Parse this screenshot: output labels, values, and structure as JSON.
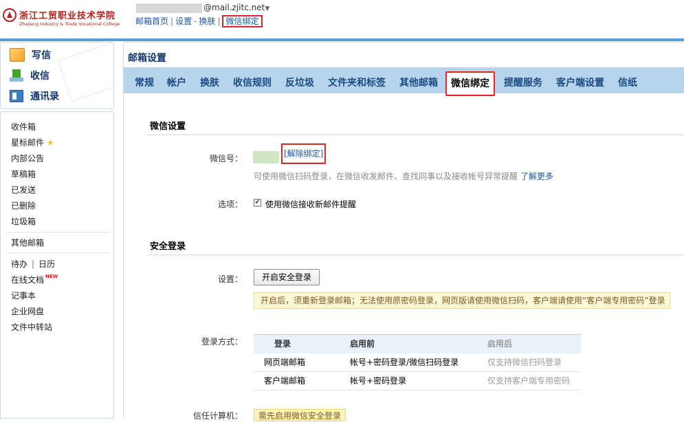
{
  "header": {
    "logo_cn": "浙江工贸职业技术学院",
    "logo_en": "Zhejiang Industry & Trade Vocational College",
    "account_suffix": "@mail.zjitc.net",
    "account_caret": "▼",
    "nav": {
      "home": "邮箱首页",
      "settings": "设置",
      "skin": "换肤",
      "wechat": "微信绑定"
    },
    "sep": "|",
    "dash": "-"
  },
  "sidebar": {
    "actions": [
      {
        "label": "写信",
        "icon": "compose-icon"
      },
      {
        "label": "收信",
        "icon": "receive-icon"
      },
      {
        "label": "通讯录",
        "icon": "contacts-icon"
      }
    ],
    "folders": {
      "inbox": "收件箱",
      "starred": "星标邮件",
      "starred_icon": "★",
      "announcements": "内部公告",
      "drafts": "草稿箱",
      "sent": "已发送",
      "deleted": "已删除",
      "spam": "垃圾箱",
      "other_mailboxes": "其他邮箱",
      "todo": "待办",
      "todo_sep": "|",
      "calendar": "日历",
      "online_docs": "在线文档",
      "new_badge": "NEW",
      "notes": "记事本",
      "netdisk": "企业网盘",
      "transfer": "文件中转站"
    }
  },
  "main": {
    "title": "邮箱设置",
    "tabs": [
      "常规",
      "帐户",
      "换肤",
      "收信规则",
      "反垃圾",
      "文件夹和标签",
      "其他邮箱",
      "微信绑定",
      "提醒服务",
      "客户端设置",
      "信纸"
    ],
    "active_tab": "微信绑定",
    "wechat_section": {
      "title": "微信设置",
      "wechat_label": "微信号：",
      "unbind_link": "[解除绑定]",
      "hint": "可使用微信扫码登录，在微信收发邮件、查找同事以及接收帐号异常提醒",
      "learn_more": "了解更多",
      "option_label": "选项：",
      "option_checked": true,
      "option_check_glyph": "✔",
      "option_text": "使用微信接收新邮件提醒"
    },
    "security_section": {
      "title": "安全登录",
      "setting_label": "设置：",
      "enable_button": "开启安全登录",
      "notice": "开启后，须重新登录邮箱；无法使用原密码登录，网页版请使用微信扫码，客户端请使用“客户端专用密码”登录",
      "login_method_label": "登录方式：",
      "table": {
        "headers": [
          "登录",
          "启用前",
          "启用后"
        ],
        "rows": [
          [
            "网页端邮箱",
            "帐号+密码登录/微信扫码登录",
            "仅支持微信扫码登录"
          ],
          [
            "客户端邮箱",
            "帐号+密码登录",
            "仅支持客户端专用密码"
          ]
        ]
      },
      "trusted_label": "信任计算机：",
      "trusted_value": "需先启用微信安全登录"
    }
  }
}
